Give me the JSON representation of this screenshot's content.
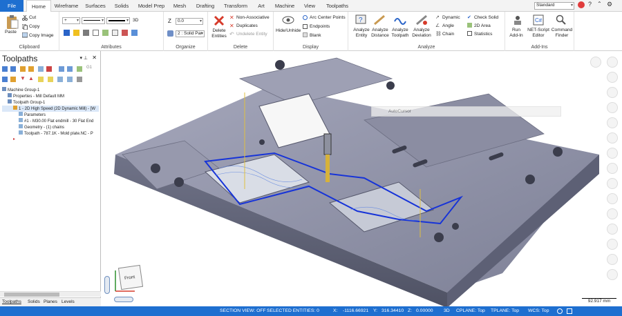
{
  "tabs": [
    "File",
    "Home",
    "Wireframe",
    "Surfaces",
    "Solids",
    "Model Prep",
    "Mesh",
    "Drafting",
    "Transform",
    "Art",
    "Machine",
    "View",
    "Toolpaths"
  ],
  "active_tab": "Home",
  "standard_combo": "Standard",
  "ribbon": {
    "clipboard": {
      "label": "Clipboard",
      "paste": "Paste",
      "cut": "Cut",
      "copy": "Copy",
      "copy_image": "Copy Image"
    },
    "attributes": {
      "label": "Attributes",
      "mode": "3D"
    },
    "organize": {
      "label": "Organize",
      "z_label": "Z",
      "z_value": "0.0",
      "level": "2 : Solid Par"
    },
    "delete": {
      "label": "Delete",
      "delete_entities": "Delete Entities",
      "non_assoc": "Non-Associative",
      "duplicates": "Duplicates",
      "undelete": "Undelete Entity"
    },
    "display": {
      "label": "Display",
      "hide_unhide": "Hide/Unhide",
      "arc_centers": "Arc Center Points",
      "endpoints": "Endpoints",
      "blank": "Blank"
    },
    "analyze": {
      "label": "Analyze",
      "entity": "Analyze Entity",
      "distance": "Analyze Distance",
      "toolpath": "Analyze Toolpath",
      "deviation": "Analyze Deviation",
      "dynamic": "Dynamic",
      "angle": "Angle",
      "chain": "Chain",
      "check_solid": "Check Solid",
      "area": "2D Area",
      "statistics": "Statistics"
    },
    "addins": {
      "label": "Add-Ins",
      "run": "Run Add-In",
      "net_editor": "NET-Script Editor",
      "finder": "Command Finder"
    }
  },
  "panel": {
    "title": "Toolpaths",
    "tree": [
      {
        "text": "Machine Group-1",
        "indent": 0
      },
      {
        "text": "Properties - Mill Default MM",
        "indent": 1
      },
      {
        "text": "Toolpath Group-1",
        "indent": 1
      },
      {
        "text": "1 - 2D High Speed (2D Dynamic Mill) - [W",
        "indent": 2
      },
      {
        "text": "Parameters",
        "indent": 3
      },
      {
        "text": "#1 - M30.00 Flat endmill - 30 Flat End",
        "indent": 3
      },
      {
        "text": "Geometry - (1) chains",
        "indent": 3
      },
      {
        "text": "Toolpath - 787.1K - Mold plate.NC - P",
        "indent": 3
      }
    ],
    "bottom_tabs": [
      "Toolpaths",
      "Solids",
      "Planes",
      "Levels"
    ]
  },
  "autocursor": "AutoCursor",
  "status": {
    "section_view": "SECTION VIEW: OFF",
    "selected": "SELECTED ENTITIES: 0",
    "x_label": "X:",
    "x": "-1116.66921",
    "y_label": "Y:",
    "y": "316.34410",
    "z_label": "Z:",
    "z": "0.00000",
    "mode": "3D",
    "cplane": "CPLANE: Top",
    "tplane": "TPLANE: Top",
    "wcs": "WCS: Top"
  },
  "scale": "92.917 mm",
  "cube_face": "Front",
  "colors": {
    "accent": "#1e6fd0",
    "part": "#8d8fa4",
    "toolpath": "#1633d8"
  }
}
